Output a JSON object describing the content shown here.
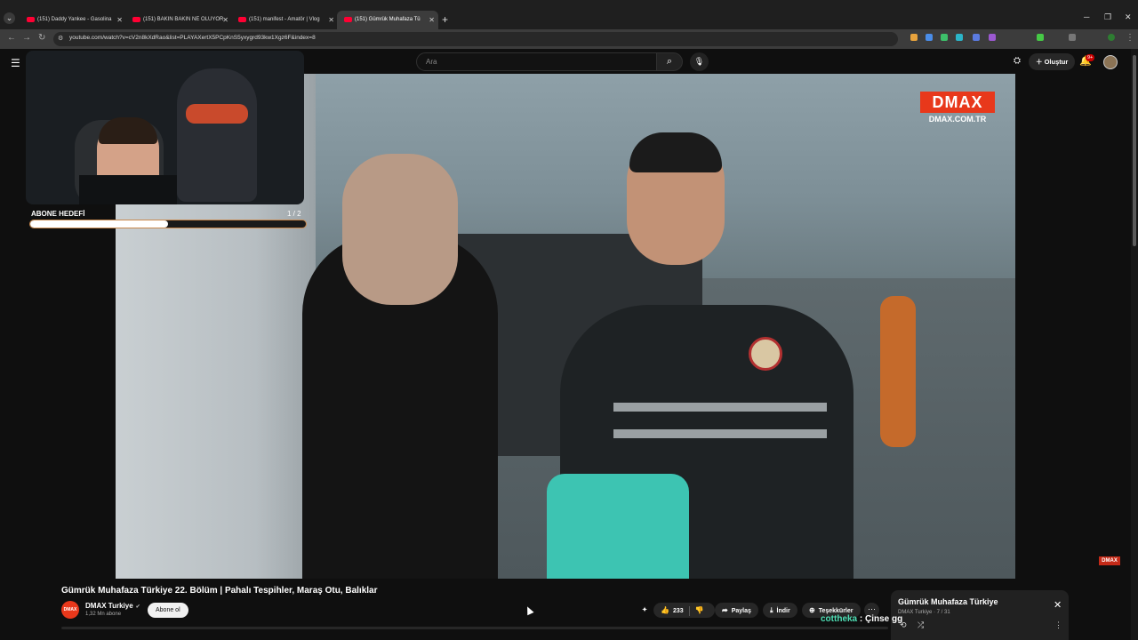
{
  "browser": {
    "tabs": [
      {
        "label": "(151) Daddy Yankee - Gasolina"
      },
      {
        "label": "(151) BAKIN BAKIN NE OLUYOR"
      },
      {
        "label": "(151) manifest - Amatör | Vlog"
      },
      {
        "label": "(151) Gümrük Muhafaza Tü"
      }
    ],
    "url": "youtube.com/watch?v=cV2n8kXdRao&list=PLAYAXertX5PCpKnS5yxygrd93kw1Xgz6F&index=8"
  },
  "youtube": {
    "search_placeholder": "Ara",
    "create_label": "Oluştur",
    "notif_count": "9+"
  },
  "overlay": {
    "goal_label": "ABONE HEDEFİ",
    "goal_count": "1 / 2",
    "goal_progress": 0.5
  },
  "video": {
    "watermark": "DMAX",
    "watermark_url": "DMAX.COM.TR",
    "corner_logo": "DMAX",
    "title": "Gümrük Muhafaza Türkiye 22. Bölüm | Pahalı Tespihler, Maraş Otu, Balıklar",
    "channel_logo": "DMAX",
    "channel_name": "DMAX Turkiye",
    "subscribers": "1,32 Mn abone",
    "subscribe_label": "Abone ol",
    "like_count": "233",
    "share_label": "Paylaş",
    "download_label": "İndir",
    "thanks_label": "Teşekkürler"
  },
  "playlist": {
    "title": "Gümrük Muhafaza Türkiye",
    "meta": "DMAX Turkiye · 7 / 31"
  },
  "chat": {
    "user": "cottheka",
    "message": " : Çinse gg"
  },
  "colors": {
    "youtube_red": "#ff0033",
    "dmax_orange": "#e8381b",
    "chat_user": "#4fe0b6",
    "goal_border": "#c9884c"
  }
}
